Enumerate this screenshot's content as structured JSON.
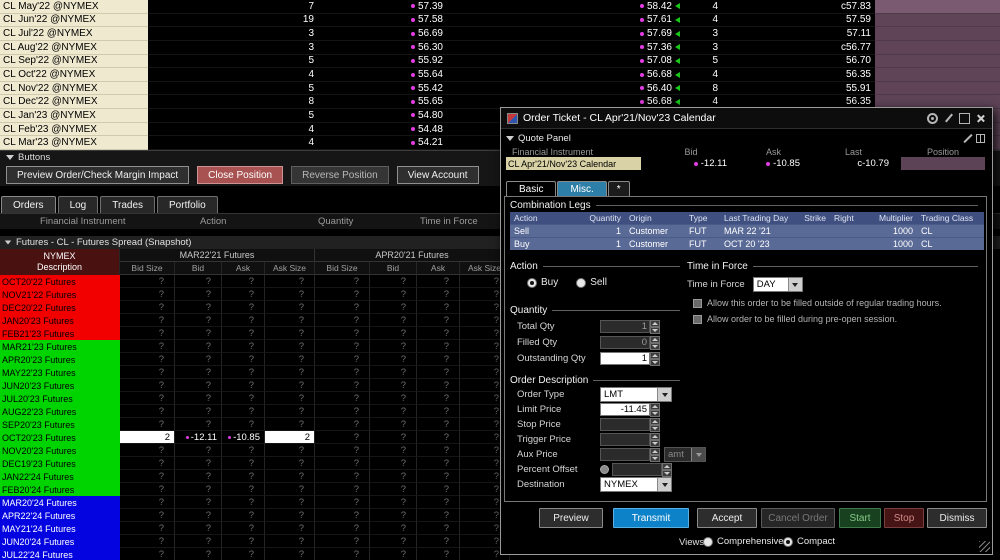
{
  "colors": {
    "accent_blue": "#0e82c8",
    "near_red": "#f20000",
    "mid_green": "#00d400",
    "far_blue": "#0404e0",
    "position_purple": "#5f4458",
    "instrument_tan": "#d9d2a6",
    "close_position_red": "#a85252",
    "misc_tab_blue": "#2e7fa8",
    "start_green": "#17411f",
    "stop_red": "#461414",
    "tick_dot_magenta": "#e23ce2",
    "tick_arrow_green": "#19c819"
  },
  "top_table": {
    "rows": [
      {
        "instrument": "CL May'22 @NYMEX",
        "size1": "7",
        "price1": "57.39",
        "price2": "58.42",
        "size2": "4",
        "price3": "c57.83"
      },
      {
        "instrument": "CL Jun'22 @NYMEX",
        "size1": "19",
        "price1": "57.58",
        "price2": "57.61",
        "size2": "4",
        "price3": "57.59"
      },
      {
        "instrument": "CL Jul'22 @NYMEX",
        "size1": "3",
        "price1": "56.69",
        "price2": "57.69",
        "size2": "3",
        "price3": "57.11"
      },
      {
        "instrument": "CL Aug'22 @NYMEX",
        "size1": "3",
        "price1": "56.30",
        "price2": "57.36",
        "size2": "3",
        "price3": "c56.77"
      },
      {
        "instrument": "CL Sep'22 @NYMEX",
        "size1": "5",
        "price1": "55.92",
        "price2": "57.08",
        "size2": "5",
        "price3": "56.70"
      },
      {
        "instrument": "CL Oct'22 @NYMEX",
        "size1": "4",
        "price1": "55.64",
        "price2": "56.68",
        "size2": "4",
        "price3": "56.35"
      },
      {
        "instrument": "CL Nov'22 @NYMEX",
        "size1": "5",
        "price1": "55.42",
        "price2": "56.40",
        "size2": "8",
        "price3": "55.91"
      },
      {
        "instrument": "CL Dec'22 @NYMEX",
        "size1": "8",
        "price1": "55.65",
        "price2": "56.68",
        "size2": "4",
        "price3": "56.35"
      },
      {
        "instrument": "CL Jan'23 @NYMEX",
        "size1": "5",
        "price1": "54.80",
        "price2": "",
        "size2": "",
        "price3": ""
      },
      {
        "instrument": "CL Feb'23 @NYMEX",
        "size1": "4",
        "price1": "54.48",
        "price2": "",
        "size2": "",
        "price3": ""
      },
      {
        "instrument": "CL Mar'23 @NYMEX",
        "size1": "4",
        "price1": "54.21",
        "price2": "",
        "size2": "",
        "price3": ""
      }
    ]
  },
  "buttons_panel": {
    "title": "Buttons",
    "buttons": [
      "Preview Order/Check Margin Impact",
      "Close Position",
      "Reverse Position",
      "View Account"
    ]
  },
  "tabs": [
    "Orders",
    "Log",
    "Trades",
    "Portfolio"
  ],
  "orders_columns": [
    "Financial Instrument",
    "Action",
    "Quantity",
    "Time in Force"
  ],
  "spread_panel": {
    "title": "Futures - CL - Futures Spread (Snapshot)",
    "exchange": "NYMEX",
    "description_label": "Description",
    "group_headers": [
      "MAR22'21 Futures",
      "APR20'21 Futures"
    ],
    "col_headers": [
      "Bid Size",
      "Bid",
      "Ask",
      "Ask Size",
      "Bid Size",
      "Bid",
      "Ask",
      "Ask Size"
    ],
    "rows": [
      {
        "label": "OCT20'22 Futures",
        "color": "red",
        "cells": [
          "?",
          "?",
          "?",
          "?",
          "?",
          "?",
          "?",
          "?"
        ]
      },
      {
        "label": "NOV21'22 Futures",
        "color": "red",
        "cells": [
          "?",
          "?",
          "?",
          "?",
          "?",
          "?",
          "?",
          "?"
        ]
      },
      {
        "label": "DEC20'22 Futures",
        "color": "red",
        "cells": [
          "?",
          "?",
          "?",
          "?",
          "?",
          "?",
          "?",
          "?"
        ]
      },
      {
        "label": "JAN20'23 Futures",
        "color": "red",
        "cells": [
          "?",
          "?",
          "?",
          "?",
          "?",
          "?",
          "?",
          "?"
        ]
      },
      {
        "label": "FEB21'23 Futures",
        "color": "red",
        "cells": [
          "?",
          "?",
          "?",
          "?",
          "?",
          "?",
          "?",
          "?"
        ]
      },
      {
        "label": "MAR21'23 Futures",
        "color": "green",
        "cells": [
          "?",
          "?",
          "?",
          "?",
          "?",
          "?",
          "?",
          "?"
        ]
      },
      {
        "label": "APR20'23 Futures",
        "color": "green",
        "cells": [
          "?",
          "?",
          "?",
          "?",
          "?",
          "?",
          "?",
          "?"
        ]
      },
      {
        "label": "MAY22'23 Futures",
        "color": "green",
        "cells": [
          "?",
          "?",
          "?",
          "?",
          "?",
          "?",
          "?",
          "?"
        ]
      },
      {
        "label": "JUN20'23 Futures",
        "color": "green",
        "cells": [
          "?",
          "?",
          "?",
          "?",
          "?",
          "?",
          "?",
          "?"
        ]
      },
      {
        "label": "JUL20'23 Futures",
        "color": "green",
        "cells": [
          "?",
          "?",
          "?",
          "?",
          "?",
          "?",
          "?",
          "?"
        ]
      },
      {
        "label": "AUG22'23 Futures",
        "color": "green",
        "cells": [
          "?",
          "?",
          "?",
          "?",
          "?",
          "?",
          "?",
          "?"
        ]
      },
      {
        "label": "SEP20'23 Futures",
        "color": "green",
        "cells": [
          "?",
          "?",
          "?",
          "?",
          "?",
          "?",
          "?",
          "?"
        ]
      },
      {
        "label": "OCT20'23 Futures",
        "color": "green",
        "cells": [
          "2",
          "-12.11",
          "-10.85",
          "2",
          "?",
          "?",
          "?",
          "?"
        ],
        "highlight": true
      },
      {
        "label": "NOV20'23 Futures",
        "color": "green",
        "cells": [
          "?",
          "?",
          "?",
          "?",
          "?",
          "?",
          "?",
          "?"
        ]
      },
      {
        "label": "DEC19'23 Futures",
        "color": "green",
        "cells": [
          "?",
          "?",
          "?",
          "?",
          "?",
          "?",
          "?",
          "?"
        ]
      },
      {
        "label": "JAN22'24 Futures",
        "color": "green",
        "cells": [
          "?",
          "?",
          "?",
          "?",
          "?",
          "?",
          "?",
          "?"
        ]
      },
      {
        "label": "FEB20'24 Futures",
        "color": "green",
        "cells": [
          "?",
          "?",
          "?",
          "?",
          "?",
          "?",
          "?",
          "?"
        ]
      },
      {
        "label": "MAR20'24 Futures",
        "color": "blue",
        "cells": [
          "?",
          "?",
          "?",
          "?",
          "?",
          "?",
          "?",
          "?"
        ]
      },
      {
        "label": "APR22'24 Futures",
        "color": "blue",
        "cells": [
          "?",
          "?",
          "?",
          "?",
          "?",
          "?",
          "?",
          "?"
        ]
      },
      {
        "label": "MAY21'24 Futures",
        "color": "blue",
        "cells": [
          "?",
          "?",
          "?",
          "?",
          "?",
          "?",
          "?",
          "?"
        ]
      },
      {
        "label": "JUN20'24 Futures",
        "color": "blue",
        "cells": [
          "?",
          "?",
          "?",
          "?",
          "?",
          "?",
          "?",
          "?"
        ]
      },
      {
        "label": "JUL22'24 Futures",
        "color": "blue",
        "cells": [
          "?",
          "?",
          "?",
          "?",
          "?",
          "?",
          "?",
          "?"
        ]
      }
    ]
  },
  "order_ticket": {
    "title": "Order Ticket - CL Apr'21/Nov'23 Calendar",
    "quote_panel": {
      "title": "Quote Panel",
      "headers": [
        "Financial Instrument",
        "Bid",
        "Ask",
        "Last",
        "Position"
      ],
      "row": {
        "instrument": "CL Apr'21/Nov'23 Calendar",
        "bid": "-12.11",
        "ask": "-10.85",
        "last": "c-10.79",
        "position": ""
      }
    },
    "tabs": [
      "Basic",
      "Misc.",
      "*"
    ],
    "combination_legs": {
      "title": "Combination Legs",
      "headers": [
        "Action",
        "Quantity",
        "Origin",
        "Type",
        "Last Trading Day",
        "Strike",
        "Right",
        "Multiplier",
        "Trading Class"
      ],
      "rows": [
        [
          "Sell",
          "1",
          "Customer",
          "FUT",
          "MAR 22 '21",
          "",
          "",
          "1000",
          "CL"
        ],
        [
          "Buy",
          "1",
          "Customer",
          "FUT",
          "OCT 20 '23",
          "",
          "",
          "1000",
          "CL"
        ]
      ]
    },
    "action": {
      "title": "Action",
      "options": [
        "Buy",
        "Sell"
      ],
      "selected": "Buy"
    },
    "time_in_force": {
      "title": "Time in Force",
      "label": "Time in Force",
      "value": "DAY",
      "checkboxes": [
        "Allow this order to be filled outside of regular trading hours.",
        "Allow order to be filled during pre-open session."
      ]
    },
    "quantity": {
      "title": "Quantity",
      "fields": [
        {
          "label": "Total Qty",
          "value": "1",
          "enabled": false
        },
        {
          "label": "Filled Qty",
          "value": "0",
          "enabled": false
        },
        {
          "label": "Outstanding Qty",
          "value": "1",
          "enabled": true
        }
      ]
    },
    "order_description": {
      "title": "Order Description",
      "fields": [
        {
          "label": "Order Type",
          "control": "dropdown",
          "value": "LMT",
          "enabled": true
        },
        {
          "label": "Limit Price",
          "control": "spin",
          "value": "-11.45",
          "enabled": true
        },
        {
          "label": "Stop Price",
          "control": "spin",
          "value": "",
          "enabled": false
        },
        {
          "label": "Trigger Price",
          "control": "spin",
          "value": "",
          "enabled": false
        },
        {
          "label": "Aux Price",
          "control": "spin-unit",
          "value": "",
          "unit": "amt",
          "enabled": false
        },
        {
          "label": "Percent Offset",
          "control": "radio-input",
          "value": "",
          "enabled": false
        },
        {
          "label": "Destination",
          "control": "dropdown",
          "value": "NYMEX",
          "enabled": true
        }
      ]
    },
    "footer_buttons": [
      {
        "label": "Preview",
        "style": ""
      },
      {
        "label": "Transmit",
        "style": "primary"
      },
      {
        "label": "Accept",
        "style": ""
      },
      {
        "label": "Cancel Order",
        "style": "disabled"
      },
      {
        "label": "Start",
        "style": "start"
      },
      {
        "label": "Stop",
        "style": "stop"
      },
      {
        "label": "Dismiss",
        "style": ""
      }
    ],
    "views": {
      "label": "Views",
      "options": [
        "Comprehensive",
        "Compact"
      ],
      "selected": "Compact"
    }
  }
}
